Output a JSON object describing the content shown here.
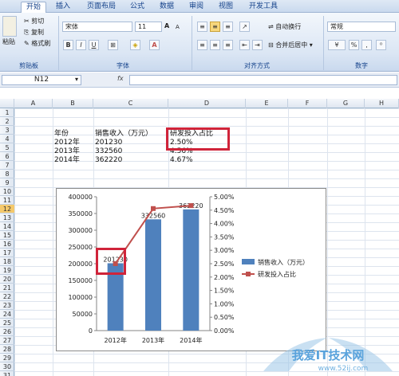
{
  "tabs": [
    "开始",
    "插入",
    "页面布局",
    "公式",
    "数据",
    "审阅",
    "视图",
    "开发工具"
  ],
  "clipboard": {
    "paste": "粘贴",
    "cut": "剪切",
    "copy": "复制",
    "format_painter": "格式刷",
    "group": "剪贴板"
  },
  "font": {
    "family": "宋体",
    "size": "11",
    "bold": "B",
    "italic": "I",
    "underline": "U",
    "grow": "A",
    "shrink": "A",
    "group": "字体"
  },
  "alignment": {
    "wrap": "自动换行",
    "merge": "合并后居中",
    "group": "对齐方式"
  },
  "number": {
    "format": "常规",
    "group": "数字",
    "percent": "%",
    "comma": ","
  },
  "formula_bar": {
    "cell": "N12",
    "fx": "fx",
    "content": ""
  },
  "columns": [
    "A",
    "B",
    "C",
    "D",
    "E",
    "F",
    "G",
    "H"
  ],
  "rows": [
    "1",
    "2",
    "3",
    "4",
    "5",
    "6",
    "7",
    "8",
    "9",
    "10",
    "11",
    "12",
    "13",
    "14",
    "15",
    "16",
    "17",
    "18",
    "19",
    "20",
    "21",
    "22",
    "23",
    "24",
    "25",
    "26",
    "27",
    "28",
    "29",
    "30",
    "31"
  ],
  "selected_row": "12",
  "table": {
    "headers": [
      "年份",
      "销售收入（万元）",
      "研发投入占比"
    ],
    "rows": [
      [
        "2012年",
        "201230",
        "2.50%"
      ],
      [
        "2013年",
        "332560",
        "4.56%"
      ],
      [
        "2014年",
        "362220",
        "4.67%"
      ]
    ]
  },
  "chart_data": {
    "type": "bar",
    "categories": [
      "2012年",
      "2013年",
      "2014年"
    ],
    "series": [
      {
        "name": "销售收入（万元）",
        "type": "bar",
        "axis": "left",
        "values": [
          201230,
          332560,
          362220
        ],
        "color": "#4f81bd"
      },
      {
        "name": "研发投入占比",
        "type": "line",
        "axis": "right",
        "values": [
          0.025,
          0.0456,
          0.0467
        ],
        "color": "#c0504d"
      }
    ],
    "data_labels": [
      "201230",
      "332560",
      "362220"
    ],
    "ylim": [
      0,
      400000
    ],
    "y_ticks": [
      "0",
      "50000",
      "100000",
      "150000",
      "200000",
      "250000",
      "300000",
      "350000",
      "400000"
    ],
    "y2lim": [
      0,
      0.05
    ],
    "y2_ticks": [
      "0.00%",
      "0.50%",
      "1.00%",
      "1.50%",
      "2.00%",
      "2.50%",
      "3.00%",
      "3.50%",
      "4.00%",
      "4.50%",
      "5.00%"
    ],
    "legend": "right",
    "grid": false
  },
  "watermark": {
    "text": "我爱IT技术网",
    "url": "www.52ij.com"
  }
}
